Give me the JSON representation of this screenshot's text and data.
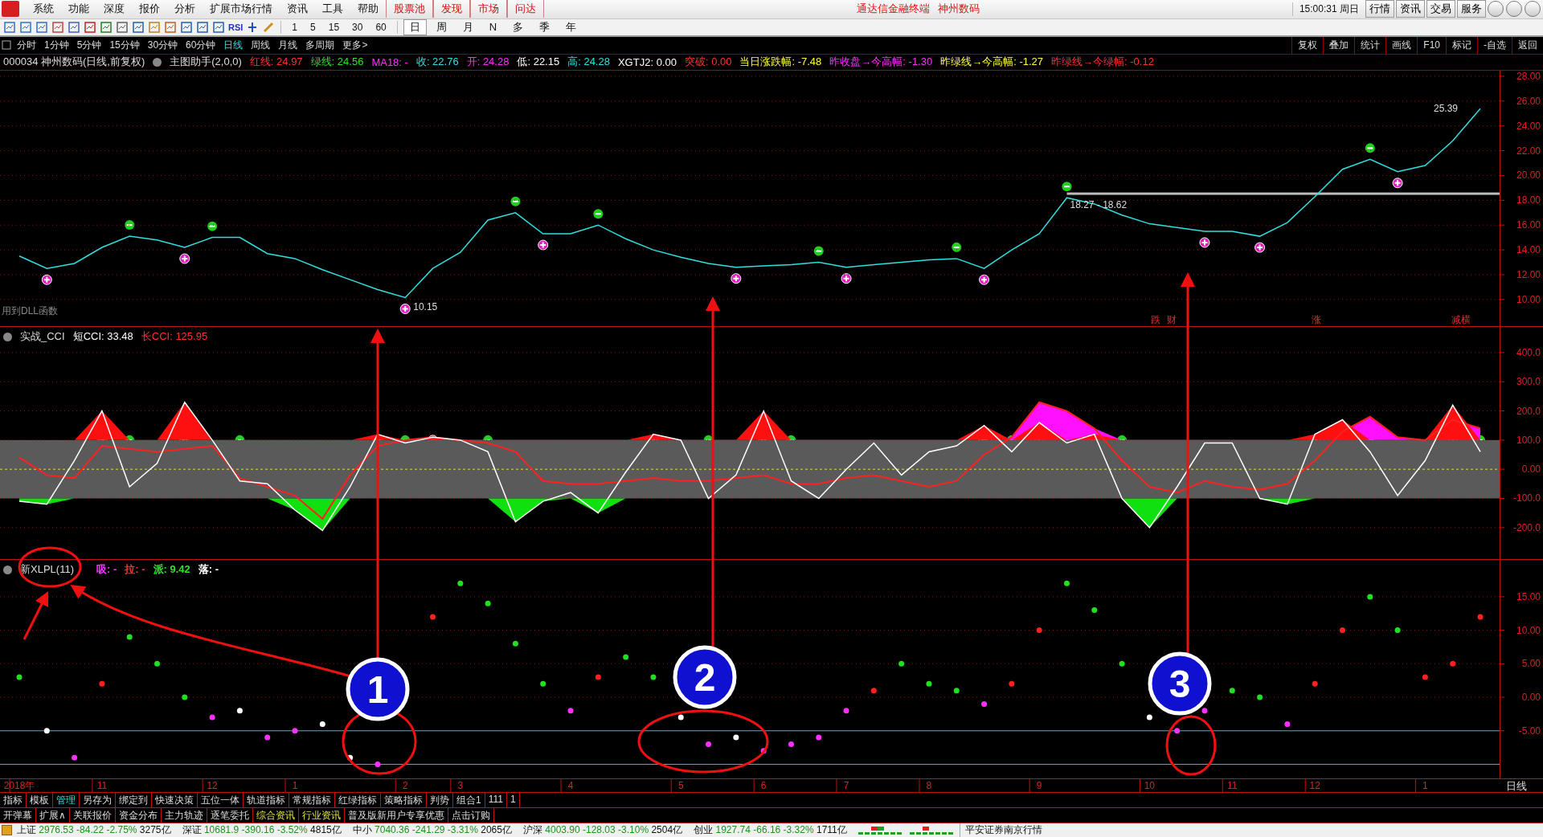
{
  "menu_bar": {
    "items": [
      {
        "label": "系统",
        "kind": "menu"
      },
      {
        "label": "功能",
        "kind": "menu"
      },
      {
        "label": "深度",
        "kind": "menu"
      },
      {
        "label": "报价",
        "kind": "menu"
      },
      {
        "label": "分析",
        "kind": "menu"
      },
      {
        "label": "扩展市场行情",
        "kind": "menu"
      },
      {
        "label": "资讯",
        "kind": "menu"
      },
      {
        "label": "工具",
        "kind": "menu"
      },
      {
        "label": "帮助",
        "kind": "menu"
      },
      {
        "label": "股票池",
        "kind": "feature"
      },
      {
        "label": "发现",
        "kind": "feature"
      },
      {
        "label": "市场",
        "kind": "feature"
      },
      {
        "label": "问达",
        "kind": "feature"
      }
    ],
    "title": "通达信金融终端   神州数码",
    "clock": "15:00:31 周日",
    "buttons": [
      "行情",
      "资讯",
      "交易",
      "服务"
    ]
  },
  "toolbar": {
    "rsi_label": "RSI",
    "minutes": [
      {
        "label": "1"
      },
      {
        "label": "5"
      },
      {
        "label": "15"
      },
      {
        "label": "30"
      },
      {
        "label": "60"
      }
    ],
    "periods": [
      {
        "label": "日",
        "selected": true
      },
      {
        "label": "周",
        "selected": false
      },
      {
        "label": "月",
        "selected": false
      },
      {
        "label": "N",
        "selected": false
      },
      {
        "label": "多",
        "selected": false
      },
      {
        "label": "季",
        "selected": false
      },
      {
        "label": "年",
        "selected": false
      }
    ]
  },
  "period_bar": {
    "tabs": [
      {
        "label": "分时",
        "selected": false
      },
      {
        "label": "1分钟",
        "selected": false
      },
      {
        "label": "5分钟",
        "selected": false
      },
      {
        "label": "15分钟",
        "selected": false
      },
      {
        "label": "30分钟",
        "selected": false
      },
      {
        "label": "60分钟",
        "selected": false
      },
      {
        "label": "日线",
        "selected": true
      },
      {
        "label": "周线",
        "selected": false
      },
      {
        "label": "月线",
        "selected": false
      },
      {
        "label": "多周期",
        "selected": false
      },
      {
        "label": "更多>",
        "selected": false
      }
    ],
    "actions": [
      "复权",
      "叠加",
      "统计",
      "画线",
      "F10",
      "标记",
      "-自选",
      "返回"
    ]
  },
  "info_line": {
    "stock": "000034 神州数码(日线,前复权)",
    "indicator": "主图助手(2,0,0)",
    "values": [
      {
        "text": "红线: 24.97",
        "color": "#ff3030"
      },
      {
        "text": "绿线: 24.56",
        "color": "#30e030"
      },
      {
        "text": "MA18: -",
        "color": "#ff30ff"
      },
      {
        "text": "收: 22.76",
        "color": "#30e0e0"
      },
      {
        "text": "开: 24.28",
        "color": "#ff30ff"
      },
      {
        "text": "低: 22.15",
        "color": "#ffffff"
      },
      {
        "text": "高: 24.28",
        "color": "#30e0e0"
      },
      {
        "text": "XGTJ2: 0.00",
        "color": "#ffffff"
      },
      {
        "text": "突破: 0.00",
        "color": "#ff3030"
      },
      {
        "text": "当日涨跌幅: -7.48",
        "color": "#ffff40"
      },
      {
        "text": "昨收盘→今高幅: -1.30",
        "color": "#ff30ff"
      },
      {
        "text": "昨绿线→今高幅: -1.27",
        "color": "#ffff40"
      },
      {
        "text": "昨绿线→今绿幅: -0.12",
        "color": "#ff3030"
      }
    ]
  },
  "price_panel": {
    "note": "用到DLL函数",
    "labels": [
      {
        "text": "25.39",
        "kind": "high"
      },
      {
        "text": "10.15",
        "kind": "low"
      },
      {
        "text": "18.27 - 18.62",
        "kind": "range"
      }
    ],
    "signals": [
      "跌",
      "财",
      "涨",
      "减横"
    ],
    "chart_data": {
      "type": "line",
      "grid": true,
      "ylim": [
        7.85,
        28.45
      ],
      "yticks": [
        {
          "value": 10,
          "label": "10.00"
        },
        {
          "value": 12,
          "label": "12.00"
        },
        {
          "value": 14,
          "label": "14.00"
        },
        {
          "value": 16,
          "label": "16.00"
        },
        {
          "value": 18,
          "label": "18.00"
        },
        {
          "value": 20,
          "label": "20.00"
        },
        {
          "value": 22,
          "label": "22.00"
        },
        {
          "value": 24,
          "label": "24.00"
        },
        {
          "value": 26,
          "label": "26.00"
        },
        {
          "value": 28,
          "label": "28.00"
        }
      ],
      "categories": [
        null,
        null,
        null,
        null,
        null,
        null,
        null,
        null,
        null,
        null,
        null,
        null,
        null,
        null,
        null,
        null,
        null,
        null,
        null,
        null,
        null,
        null,
        null,
        null,
        null,
        null,
        null,
        null,
        null,
        null,
        null,
        null,
        null,
        null,
        null,
        null,
        null,
        null,
        null,
        null,
        null,
        null,
        null,
        null,
        null,
        null,
        null,
        null,
        null,
        null,
        null,
        null,
        null,
        null
      ],
      "series": [
        {
          "color": "#30e0e0",
          "values": [
            13.5,
            12.5,
            12.9,
            14.2,
            15.1,
            14.8,
            14.2,
            15,
            15,
            13.7,
            13.3,
            12.4,
            11.6,
            10.8,
            10.15,
            12.5,
            13.8,
            16.4,
            17,
            15.3,
            15.3,
            16,
            14.9,
            14,
            13.4,
            12.9,
            12.6,
            12.7,
            12.8,
            13,
            12.6,
            12.8,
            13,
            13.2,
            13.3,
            12.5,
            14,
            15.3,
            18.2,
            17.7,
            16.8,
            16.1,
            15.8,
            15.5,
            15.5,
            15.1,
            16.2,
            18.3,
            20.5,
            21.3,
            20.3,
            20.8,
            22.8,
            25.39
          ]
        }
      ]
    }
  },
  "cci_panel": {
    "title": "实战_CCI",
    "readings": [
      {
        "text": "短CCI: 33.48",
        "color": "#ffffff"
      },
      {
        "text": "长CCI: 125.95",
        "color": "#ff3030"
      }
    ],
    "chart_data": {
      "type": "line",
      "grid": true,
      "ylim": [
        -308,
        488
      ],
      "yticks": [
        {
          "value": -200,
          "label": "-200.0"
        },
        {
          "value": -100,
          "label": "-100.0"
        },
        {
          "value": 0,
          "label": "0.00"
        },
        {
          "value": 100,
          "label": "100.0"
        },
        {
          "value": 200,
          "label": "200.0"
        },
        {
          "value": 300,
          "label": "300.0"
        },
        {
          "value": 400,
          "label": "400.0"
        }
      ],
      "categories": [
        null,
        null,
        null,
        null,
        null,
        null,
        null,
        null,
        null,
        null,
        null,
        null,
        null,
        null,
        null,
        null,
        null,
        null,
        null,
        null,
        null,
        null,
        null,
        null,
        null,
        null,
        null,
        null,
        null,
        null,
        null,
        null,
        null,
        null,
        null,
        null,
        null,
        null,
        null,
        null,
        null,
        null,
        null,
        null,
        null,
        null,
        null,
        null,
        null,
        null,
        null,
        null,
        null,
        null
      ],
      "series": [
        {
          "color": "#ffffff",
          "values": [
            -110,
            -120,
            30,
            200,
            -60,
            20,
            230,
            100,
            -40,
            -50,
            -140,
            -210,
            -60,
            120,
            90,
            110,
            100,
            60,
            -180,
            -110,
            -80,
            -150,
            -10,
            120,
            100,
            -100,
            -20,
            200,
            -40,
            -100,
            0,
            90,
            -20,
            60,
            80,
            150,
            60,
            160,
            90,
            120,
            -100,
            -200,
            -60,
            90,
            90,
            -100,
            -120,
            120,
            170,
            60,
            -90,
            30,
            220,
            60
          ]
        },
        {
          "color": "#ff2020",
          "values": [
            40,
            -20,
            -30,
            80,
            70,
            60,
            70,
            80,
            -30,
            -60,
            -90,
            -170,
            -20,
            80,
            100,
            110,
            100,
            90,
            60,
            -40,
            -50,
            -50,
            -40,
            -30,
            -40,
            -40,
            -30,
            -20,
            -50,
            -50,
            -30,
            -20,
            -40,
            -60,
            -40,
            50,
            110,
            230,
            200,
            140,
            30,
            -60,
            -80,
            -40,
            -60,
            -70,
            -50,
            30,
            130,
            180,
            110,
            100,
            170,
            140
          ]
        }
      ]
    }
  },
  "xlpl_panel": {
    "title": "新XLPL(11)",
    "readings": [
      {
        "text": "吸: -",
        "color": "#ff30ff"
      },
      {
        "text": "拉: -",
        "color": "#ff3030"
      },
      {
        "text": "派: 9.42",
        "color": "#30e030"
      },
      {
        "text": "落: -",
        "color": "#ffffff"
      }
    ],
    "chart_data": {
      "type": "scatter",
      "grid": true,
      "ylim": [
        -12.1,
        20.5
      ],
      "yticks": [
        {
          "value": -5,
          "label": "-5.00"
        },
        {
          "value": 0,
          "label": "0.00"
        },
        {
          "value": 5,
          "label": "5.00"
        },
        {
          "value": 10,
          "label": "10.00"
        },
        {
          "value": 15,
          "label": "15.00"
        }
      ],
      "categories": [
        "2018年",
        null,
        null,
        "11",
        null,
        null,
        null,
        "12",
        null,
        null,
        "1",
        null,
        null,
        null,
        "2",
        null,
        "3",
        null,
        null,
        null,
        "4",
        null,
        null,
        null,
        "5",
        null,
        null,
        "6",
        null,
        null,
        "7",
        null,
        null,
        "8",
        null,
        null,
        null,
        "9",
        null,
        null,
        null,
        "10",
        null,
        null,
        "11",
        null,
        null,
        "12",
        null,
        null,
        null,
        "1",
        null,
        null
      ],
      "series": [
        {
          "color": "#ff30ff",
          "values": [
            null,
            null,
            -9,
            null,
            null,
            null,
            null,
            -3,
            null,
            -6,
            -5,
            null,
            null,
            -10,
            null,
            null,
            null,
            null,
            null,
            null,
            -2,
            null,
            null,
            null,
            null,
            -7,
            null,
            -8,
            -7,
            -6,
            -2,
            null,
            null,
            null,
            null,
            -1,
            null,
            null,
            null,
            null,
            null,
            null,
            -5,
            -2,
            null,
            null,
            -4,
            null,
            null,
            null,
            null,
            null,
            null,
            null
          ]
        },
        {
          "color": "#ff2020",
          "values": [
            null,
            null,
            null,
            2,
            null,
            null,
            null,
            null,
            null,
            null,
            null,
            null,
            null,
            null,
            null,
            12,
            null,
            null,
            null,
            null,
            null,
            3,
            null,
            null,
            null,
            null,
            null,
            null,
            null,
            null,
            null,
            1,
            null,
            null,
            null,
            null,
            2,
            10,
            null,
            null,
            null,
            null,
            null,
            null,
            null,
            null,
            null,
            2,
            10,
            null,
            null,
            3,
            5,
            12
          ]
        },
        {
          "color": "#20e020",
          "values": [
            3,
            null,
            null,
            null,
            9,
            5,
            0,
            null,
            null,
            null,
            null,
            null,
            null,
            null,
            null,
            null,
            17,
            14,
            8,
            2,
            null,
            null,
            6,
            3,
            null,
            null,
            null,
            null,
            null,
            null,
            null,
            null,
            5,
            2,
            1,
            null,
            null,
            null,
            17,
            13,
            5,
            null,
            null,
            null,
            1,
            0,
            null,
            null,
            null,
            15,
            10,
            null,
            null,
            null
          ]
        },
        {
          "color": "#ffffff",
          "values": [
            null,
            -5,
            null,
            null,
            null,
            null,
            null,
            null,
            -2,
            null,
            null,
            -4,
            -9,
            null,
            null,
            null,
            null,
            null,
            null,
            null,
            null,
            null,
            null,
            null,
            -3,
            null,
            -6,
            null,
            null,
            null,
            null,
            null,
            null,
            null,
            null,
            null,
            null,
            null,
            null,
            null,
            null,
            -3,
            null,
            null,
            null,
            null,
            null,
            null,
            null,
            null,
            null,
            null,
            null,
            null
          ]
        }
      ]
    }
  },
  "date_axis": {
    "period_label": "日线"
  },
  "callouts": [
    {
      "label": "1"
    },
    {
      "label": "2"
    },
    {
      "label": "3"
    }
  ],
  "tab_rows": [
    [
      {
        "label": "指标",
        "selected": false
      },
      {
        "label": "模板",
        "selected": false
      },
      {
        "label": "管理",
        "selected": true
      },
      {
        "label": "另存为",
        "selected": false
      },
      {
        "label": "绑定到",
        "selected": false
      },
      {
        "label": "快速决策",
        "selected": false
      },
      {
        "label": "五位一体",
        "selected": false
      },
      {
        "label": "轨道指标",
        "selected": false
      },
      {
        "label": "常规指标",
        "selected": false
      },
      {
        "label": "红绿指标",
        "selected": false
      },
      {
        "label": "策略指标",
        "selected": false
      },
      {
        "label": "判势",
        "selected": false
      },
      {
        "label": "组合1",
        "selected": false
      },
      {
        "label": "111",
        "selected": false
      },
      {
        "label": "1",
        "selected": false
      }
    ],
    [
      {
        "label": "开弹幕",
        "selected": false
      },
      {
        "label": "扩展∧",
        "selected": false
      },
      {
        "label": "关联报价",
        "selected": false
      },
      {
        "label": "资金分布",
        "selected": false
      },
      {
        "label": "主力轨迹",
        "selected": false
      },
      {
        "label": "逐笔委托",
        "selected": false
      },
      {
        "label": "综合资讯",
        "selected": true
      },
      {
        "label": "行业资讯",
        "selected": true
      },
      {
        "label": "普及版新用户专享优惠",
        "selected": false
      },
      {
        "label": "点击订购",
        "selected": false
      }
    ]
  ],
  "status_bar": {
    "indices": [
      {
        "name": "上证",
        "value": "2976.53",
        "change": "-84.22",
        "percent": "-2.75%",
        "amount": "3275亿"
      },
      {
        "name": "深证",
        "value": "10681.9",
        "change": "-390.16",
        "percent": "-3.52%",
        "amount": "4815亿"
      },
      {
        "name": "中小",
        "value": "7040.36",
        "change": "-241.29",
        "percent": "-3.31%",
        "amount": "2065亿"
      },
      {
        "name": "沪深",
        "value": "4003.90",
        "change": "-128.03",
        "percent": "-3.10%",
        "amount": "2504亿"
      },
      {
        "name": "创业",
        "value": "1927.74",
        "change": "-66.16",
        "percent": "-3.32%",
        "amount": "1711亿"
      }
    ],
    "broker": "平安证券南京行情"
  }
}
